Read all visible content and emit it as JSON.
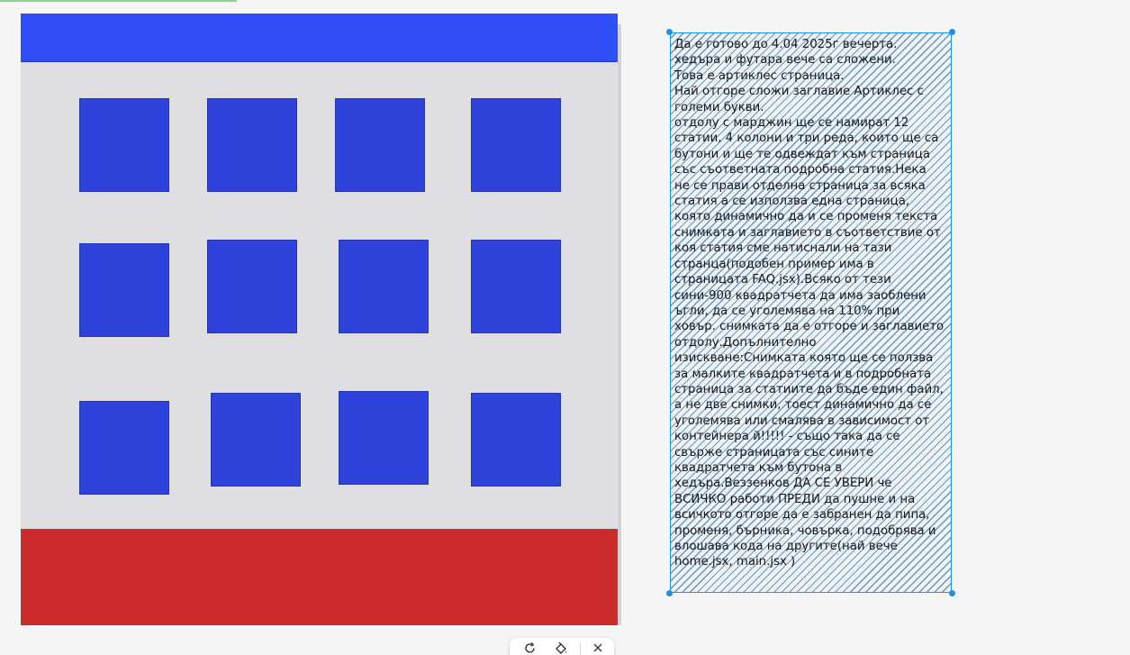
{
  "note": {
    "text": "Да е готово до 4.04 2025г вечерта.\nхедъра и футара вече са сложени.\nТова е артиклес страница.\nНай отгоре сложи заглавие Артиклес с големи букви.\nотдолу с марджин ще се намират 12 статии, 4 колони и три реда, които ще са бутони и ще те одвеждат към страница със съответната подробна статия.Нека не се прави отделна страница за всяка статия а се използва една страница, която динамично да и се променя текста снимката и заглавието в съответствие от коя статия сме натиснали на тази странца(подобен пример има в страницата FAQ.jsx).Всяко от тези сини-900 квадратчета  да има заоблени ъгли, да се уголемява на 110% при ховър.  снимката да е  отгоре и заглавието отдолу.Допълнително изискване:Снимката която ще се ползва за малките квадратчета и в подробната страница за статиите да бъде един файл, а не две снимки, тоест динамично да се уголемява или смалява в зависимост от контейнера й!!!!! - също така да се свърже страницата със сините квадратчета към бутона в хедъра.Веззенков ДА СЕ УВЕРИ че ВСИЧКО работи ПРЕДИ да пушне и на всичкото отгоре да е забранен да пипа, променя, бърника, човърка, подобрява и влошава кода на другите(най вече home.jsx, main.jsx )"
  },
  "wireframe": {
    "header_color": "#304ef7",
    "footer_color": "#cb2b2b",
    "tile_color": "#2f42d9",
    "background_color": "#dfdfe1",
    "tile_rows": 3,
    "tile_columns": 4
  },
  "toolbar": {
    "icons": [
      "rotate-icon",
      "paint-icon",
      "close-icon"
    ]
  },
  "colors": {
    "selection": "#1e90e8",
    "hatch": "#6c93b8"
  }
}
